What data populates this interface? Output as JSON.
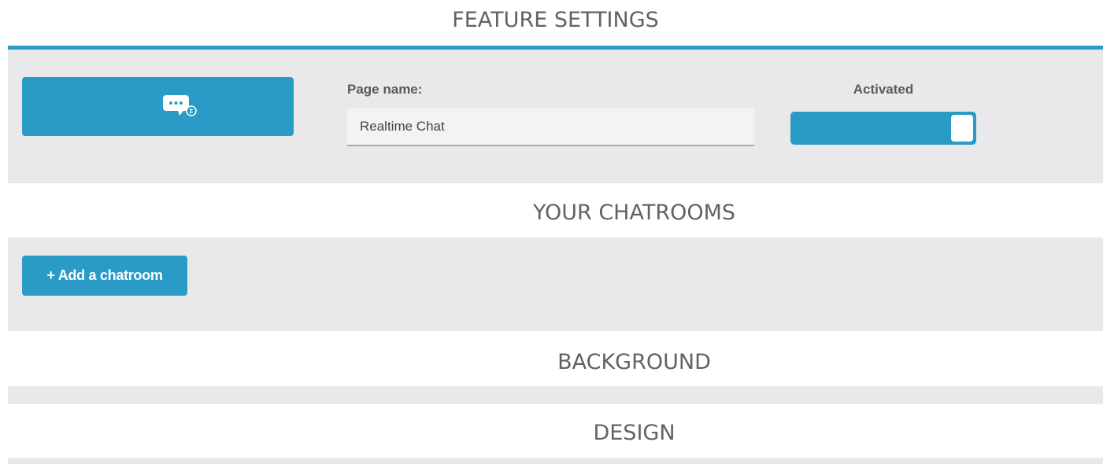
{
  "colors": {
    "accent": "#2a9ac7",
    "panel_bg": "#e9e9eb",
    "heading_text": "#5f6368",
    "label_text": "#5a5a5a"
  },
  "sections": {
    "feature_settings": {
      "title": "FEATURE SETTINGS",
      "icon": "chat-bubble-icon",
      "page_name_label": "Page name:",
      "page_name_value": "Realtime Chat",
      "activated_label": "Activated",
      "activated": true
    },
    "chatrooms": {
      "title": "YOUR CHATROOMS",
      "add_button_label": "+ Add a chatroom"
    },
    "background": {
      "title": "BACKGROUND"
    },
    "design": {
      "title": "DESIGN"
    }
  }
}
